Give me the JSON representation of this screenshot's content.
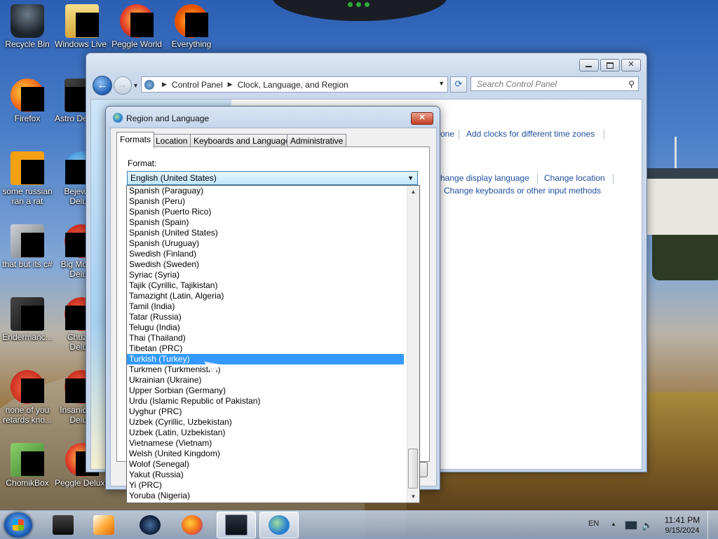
{
  "desktop": {
    "icons": [
      {
        "label": "Recycle Bin",
        "icon": "recycle-bin-icon"
      },
      {
        "label": "Windows Live Ma",
        "icon": "windows-live-mail-icon"
      },
      {
        "label": "Peggle World",
        "icon": "peggle-world-icon"
      },
      {
        "label": "Everything",
        "icon": "everything-icon"
      },
      {
        "label": "Firefox",
        "icon": "firefox-icon"
      },
      {
        "label": "Astro Delu",
        "icon": "astro-deluxe-icon"
      },
      {
        "label": "some russian ran a rat",
        "icon": "app-icon"
      },
      {
        "label": "Bejew Delu",
        "icon": "bejeweled-icon"
      },
      {
        "label": "that but its c#",
        "icon": "app-icon"
      },
      {
        "label": "Big Mo Delu",
        "icon": "game-icon"
      },
      {
        "label": "Endermanc...",
        "icon": "app-icon"
      },
      {
        "label": "Chuz Delu",
        "icon": "game-icon"
      },
      {
        "label": "none of you retards kno...",
        "icon": "app-icon"
      },
      {
        "label": "Insaniq Delu",
        "icon": "game-icon"
      },
      {
        "label": "ChomikBox",
        "icon": "chomikbox-icon"
      },
      {
        "label": "Peggle Deluxe",
        "icon": "peggle-icon"
      }
    ]
  },
  "control_panel": {
    "breadcrumb": [
      "Control Panel",
      "Clock, Language, and Region"
    ],
    "search_placeholder": "Search Control Panel",
    "links": {
      "time_zone_partial": "one",
      "add_clocks": "Add clocks for different time zones",
      "change_display_language": "hange display language",
      "change_location": "Change location",
      "change_keyboards": "Change keyboards or other input methods"
    },
    "close_glyph": "✕"
  },
  "dialog": {
    "title": "Region and Language",
    "close_glyph": "✕",
    "tabs": [
      {
        "label": "Formats",
        "active": true
      },
      {
        "label": "Location",
        "active": false
      },
      {
        "label": "Keyboards and Languages",
        "active": false
      },
      {
        "label": "Administrative",
        "active": false
      }
    ],
    "format_label": "Format:",
    "format_value": "English (United States)",
    "format_options": [
      "Spanish (Paraguay)",
      "Spanish (Peru)",
      "Spanish (Puerto Rico)",
      "Spanish (Spain)",
      "Spanish (United States)",
      "Spanish (Uruguay)",
      "Swedish (Finland)",
      "Swedish (Sweden)",
      "Syriac (Syria)",
      "Tajik (Cyrillic, Tajikistan)",
      "Tamazight (Latin, Algeria)",
      "Tamil (India)",
      "Tatar (Russia)",
      "Telugu (India)",
      "Thai (Thailand)",
      "Tibetan (PRC)",
      "Turkish (Turkey)",
      "Turkmen (Turkmenistan)",
      "Ukrainian (Ukraine)",
      "Upper Sorbian (Germany)",
      "Urdu (Islamic Republic of Pakistan)",
      "Uyghur (PRC)",
      "Uzbek (Cyrillic, Uzbekistan)",
      "Uzbek (Latin, Uzbekistan)",
      "Vietnamese (Vietnam)",
      "Welsh (United Kingdom)",
      "Wolof (Senegal)",
      "Yakut (Russia)",
      "Yi (PRC)",
      "Yoruba (Nigeria)"
    ],
    "highlighted_option": "Turkish (Turkey)"
  },
  "taskbar": {
    "items": [
      {
        "icon": "media-device-icon",
        "active": false
      },
      {
        "icon": "media-player-icon",
        "active": false
      },
      {
        "icon": "globe-icon",
        "active": false
      },
      {
        "icon": "firefox-icon",
        "active": false
      },
      {
        "icon": "control-panel-icon",
        "active": true
      },
      {
        "icon": "region-language-icon",
        "active": true
      }
    ],
    "language": "EN",
    "time": "11:41 PM",
    "date": "9/15/2024"
  },
  "colors": {
    "selection": "#3399ff",
    "link": "#1e4e9c"
  }
}
